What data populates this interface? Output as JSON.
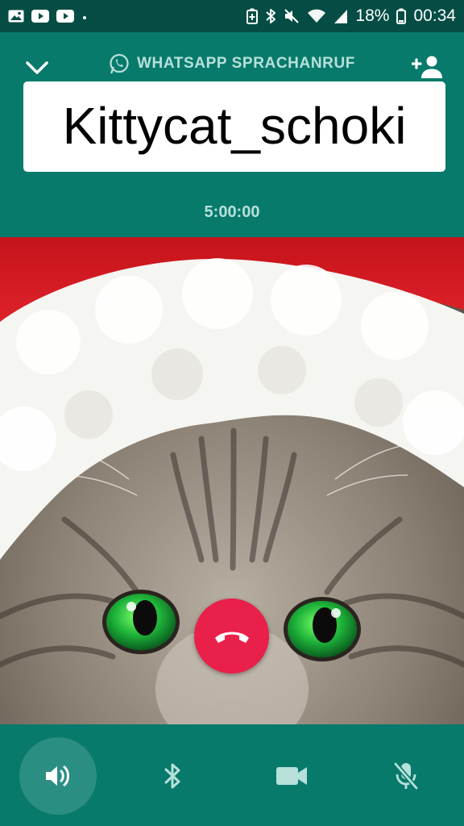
{
  "status_bar": {
    "battery_percent": "18%",
    "time": "00:34",
    "left_icons": [
      "gallery-icon",
      "youtube-icon",
      "youtube-icon",
      "dot-icon"
    ],
    "right_icons": [
      "battery-saver-icon",
      "bluetooth-icon",
      "mute-icon",
      "wifi-icon",
      "signal-icon",
      "battery-icon"
    ]
  },
  "header": {
    "call_type": "WHATSAPP SPRACHANRUF",
    "contact_name": "Kittycat_schoki",
    "call_duration": "5:00:00",
    "accent_color": "#087a6c",
    "label_color": "#b7e0da"
  },
  "end_call": {
    "color": "#e8204a",
    "icon": "hangup-phone-icon"
  },
  "controls": [
    {
      "name": "speaker",
      "icon": "speaker-icon",
      "active": true
    },
    {
      "name": "bluetooth",
      "icon": "bluetooth-icon",
      "active": false
    },
    {
      "name": "video",
      "icon": "video-camera-icon",
      "active": false
    },
    {
      "name": "mute",
      "icon": "mic-off-icon",
      "active": false
    }
  ]
}
